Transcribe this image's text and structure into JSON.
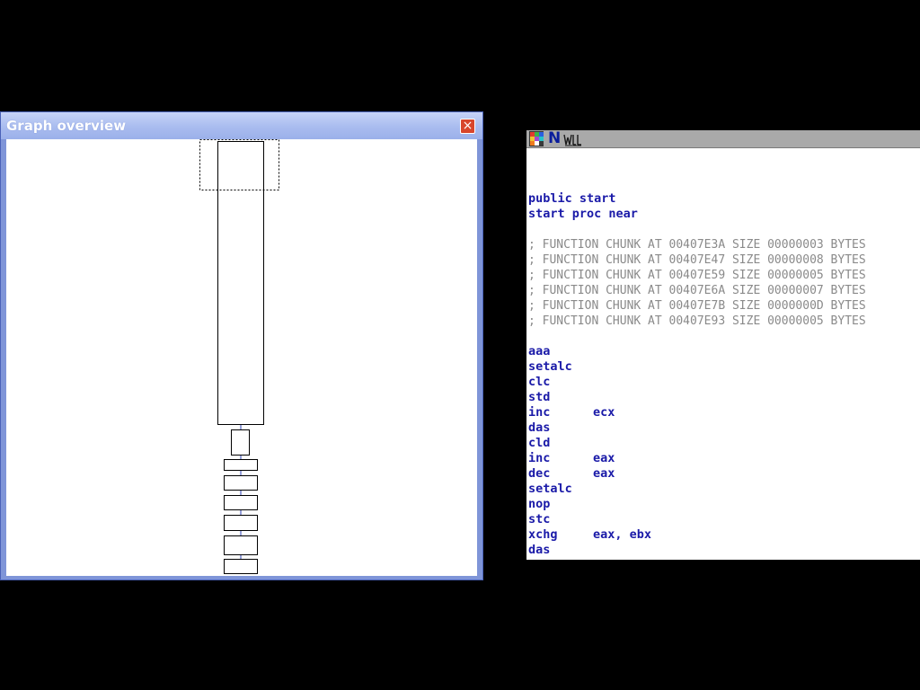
{
  "graph_overview": {
    "title": "Graph overview",
    "close_glyph": "×"
  },
  "disassembly": {
    "toolbar_icons": [
      "palette-icon",
      "names-icon",
      "strings-icon"
    ],
    "names_icon_glyph": "N",
    "header": [
      "public start",
      "start proc near"
    ],
    "comments": [
      "; FUNCTION CHUNK AT 00407E3A SIZE 00000003 BYTES",
      "; FUNCTION CHUNK AT 00407E47 SIZE 00000008 BYTES",
      "; FUNCTION CHUNK AT 00407E59 SIZE 00000005 BYTES",
      "; FUNCTION CHUNK AT 00407E6A SIZE 00000007 BYTES",
      "; FUNCTION CHUNK AT 00407E7B SIZE 0000000D BYTES",
      "; FUNCTION CHUNK AT 00407E93 SIZE 00000005 BYTES"
    ],
    "instructions": [
      {
        "mnemonic": "aaa",
        "operands": ""
      },
      {
        "mnemonic": "setalc",
        "operands": ""
      },
      {
        "mnemonic": "clc",
        "operands": ""
      },
      {
        "mnemonic": "std",
        "operands": ""
      },
      {
        "mnemonic": "inc",
        "operands": "ecx"
      },
      {
        "mnemonic": "das",
        "operands": ""
      },
      {
        "mnemonic": "cld",
        "operands": ""
      },
      {
        "mnemonic": "inc",
        "operands": "eax"
      },
      {
        "mnemonic": "dec",
        "operands": "eax"
      },
      {
        "mnemonic": "setalc",
        "operands": ""
      },
      {
        "mnemonic": "nop",
        "operands": ""
      },
      {
        "mnemonic": "stc",
        "operands": ""
      },
      {
        "mnemonic": "xchg",
        "operands": "eax, ebx"
      },
      {
        "mnemonic": "das",
        "operands": ""
      }
    ]
  },
  "colors": {
    "code_blue": "#1a1aa8",
    "comment_gray": "#8a8a8a",
    "title_bar": "#a9bcef",
    "close_red": "#d8462c"
  }
}
